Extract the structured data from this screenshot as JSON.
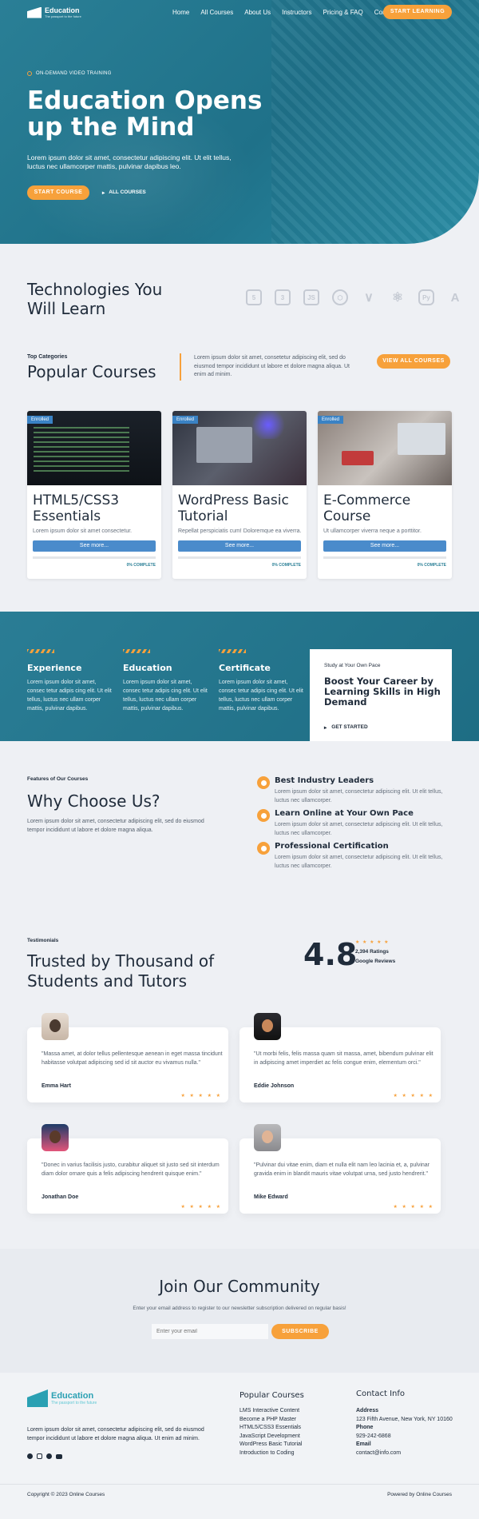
{
  "brand": {
    "name": "Education",
    "tagline": "The passport to the future"
  },
  "nav": {
    "items": [
      "Home",
      "All Courses",
      "About Us",
      "Instructors",
      "Pricing & FAQ",
      "Contact"
    ],
    "cta": "START LEARNING"
  },
  "hero": {
    "eyebrow": "ON-DEMAND VIDEO TRAINING",
    "title_line1": "Education Opens",
    "title_line2": "up the Mind",
    "text": "Lorem ipsum dolor sit amet, consectetur adipiscing elit. Ut elit tellus, luctus nec ullamcorper mattis, pulvinar dapibus leo.",
    "primary_button": "START COURSE",
    "secondary_button": "ALL COURSES"
  },
  "tech": {
    "title_line1": "Technologies You",
    "title_line2": "Will Learn",
    "icons": [
      "html5-icon",
      "css3-icon",
      "js-icon",
      "nodejs-icon",
      "vue-icon",
      "react-icon",
      "python-icon",
      "angular-icon"
    ]
  },
  "popular": {
    "eyebrow": "Top Categories",
    "title": "Popular Courses",
    "text": "Lorem ipsum dolor sit amet, consetetur adipiscing elit, sed do eiusmod tempor incididunt ut labore et dolore magna aliqua. Ut enim ad minim.",
    "button": "VIEW ALL COURSES"
  },
  "courses": [
    {
      "badge": "Enrolled",
      "title": "HTML5/CSS3 Essentials",
      "desc": "Lorem ipsum dolor sit amet consectetur.",
      "button": "See more...",
      "progress": "0% COMPLETE"
    },
    {
      "badge": "Enrolled",
      "title": "WordPress Basic Tutorial",
      "desc": "Repellat perspiciatis cum! Doloremque ea viverra.",
      "button": "See more...",
      "progress": "0% COMPLETE"
    },
    {
      "badge": "Enrolled",
      "title": "E-Commerce Course",
      "desc": "Ut ullamcorper viverra neque a porttitor.",
      "button": "See more...",
      "progress": "0% COMPLETE"
    }
  ],
  "features": [
    {
      "title": "Experience",
      "text": "Lorem ipsum dolor sit amet, consec tetur adipis cing elit. Ut elit tellus, luctus nec ullam corper mattis, pulvinar dapibus."
    },
    {
      "title": "Education",
      "text": "Lorem ipsum dolor sit amet, consec tetur adipis cing elit. Ut elit tellus, luctus nec ullam corper mattis, pulvinar dapibus."
    },
    {
      "title": "Certificate",
      "text": "Lorem ipsum dolor sit amet, consec tetur adipis cing elit. Ut elit tellus, luctus nec ullam corper mattis, pulvinar dapibus."
    }
  ],
  "career": {
    "eyebrow": "Study at Your Own Pace",
    "title": "Boost Your Career by Learning Skills in High Demand",
    "link": "GET STARTED"
  },
  "why": {
    "eyebrow": "Features of Our Courses",
    "title": "Why Choose Us?",
    "text": "Lorem ipsum dolor sit amet, consectetur adipiscing elit, sed do eiusmod tempor incididunt ut labore et dolore magna aliqua.",
    "items": [
      {
        "title": "Best Industry Leaders",
        "text": "Lorem ipsum dolor sit amet, consectetur adipiscing elit. Ut elit tellus, luctus nec ullamcorper."
      },
      {
        "title": "Learn Online at Your Own Pace",
        "text": "Lorem ipsum dolor sit amet, consectetur adipiscing elit. Ut elit tellus, luctus nec ullamcorper."
      },
      {
        "title": "Professional Certification",
        "text": "Lorem ipsum dolor sit amet, consectetur adipiscing elit. Ut elit tellus, luctus nec ullamcorper."
      }
    ]
  },
  "testimonials": {
    "eyebrow": "Testimonials",
    "title_line1": "Trusted by Thousand of",
    "title_line2": "Students and Tutors",
    "rating": "4.8",
    "ratings_count": "2,394 Ratings",
    "ratings_source": "Google Reviews",
    "stars": "★ ★ ★ ★ ★",
    "items": [
      {
        "quote": "\"Massa amet, at dolor tellus pellentesque aenean in eget massa tincidunt habitasse volutpat adipiscing sed id sit auctor eu vivamus nulla.\"",
        "name": "Emma Hart"
      },
      {
        "quote": "\"Ut morbi felis, felis massa quam sit massa, amet, bibendum pulvinar elit in adipiscing amet imperdiet ac felis congue enim, elementum orci.\"",
        "name": "Eddie Johnson"
      },
      {
        "quote": "\"Donec in varius facilisis justo, curabitur aliquet sit justo sed sit interdum diam dolor ornare quis a felis adipiscing hendrerit quisque enim.\"",
        "name": "Jonathan Doe"
      },
      {
        "quote": "\"Pulvinar dui vitae enim, diam et nulla elit nam leo lacinia et, a, pulvinar gravida enim in blandit mauris vitae volutpat urna, sed justo hendrerit.\"",
        "name": "Mike Edward"
      }
    ]
  },
  "community": {
    "title": "Join Our Community",
    "text": "Enter your email address to register to our newsletter subscription delivered on regular basis!",
    "placeholder": "Enter your email",
    "button": "SUBSCRIBE"
  },
  "footer": {
    "brand": "Education",
    "tagline": "The passport to the future",
    "text": "Lorem ipsum dolor sit amet, consectetur adipiscing elit, sed do eiusmod tempor incididunt ut labore et dolore magna aliqua. Ut enim ad minim.",
    "social": [
      "facebook-icon",
      "instagram-icon",
      "pinterest-icon",
      "youtube-icon"
    ],
    "courses_title": "Popular Courses",
    "courses": [
      "LMS Interactive Content",
      "Become a PHP Master",
      "HTML5/CSS3 Essentials",
      "JavaScript Development",
      "WordPress Basic Tutorial",
      "Introduction to Coding"
    ],
    "contact_title": "Contact Info",
    "address_label": "Address",
    "address": "123 Fifth Avenue, New York, NY 10160",
    "phone_label": "Phone",
    "phone": "929-242-6868",
    "email_label": "Email",
    "email": "contact@info.com",
    "copyright": "Copyright © 2023 Online Courses",
    "powered": "Powered by Online Courses"
  },
  "colors": {
    "primary": "#1f7189",
    "accent": "#f7a13b",
    "button_blue": "#4a8bcb",
    "dark": "#1f2b3a"
  }
}
